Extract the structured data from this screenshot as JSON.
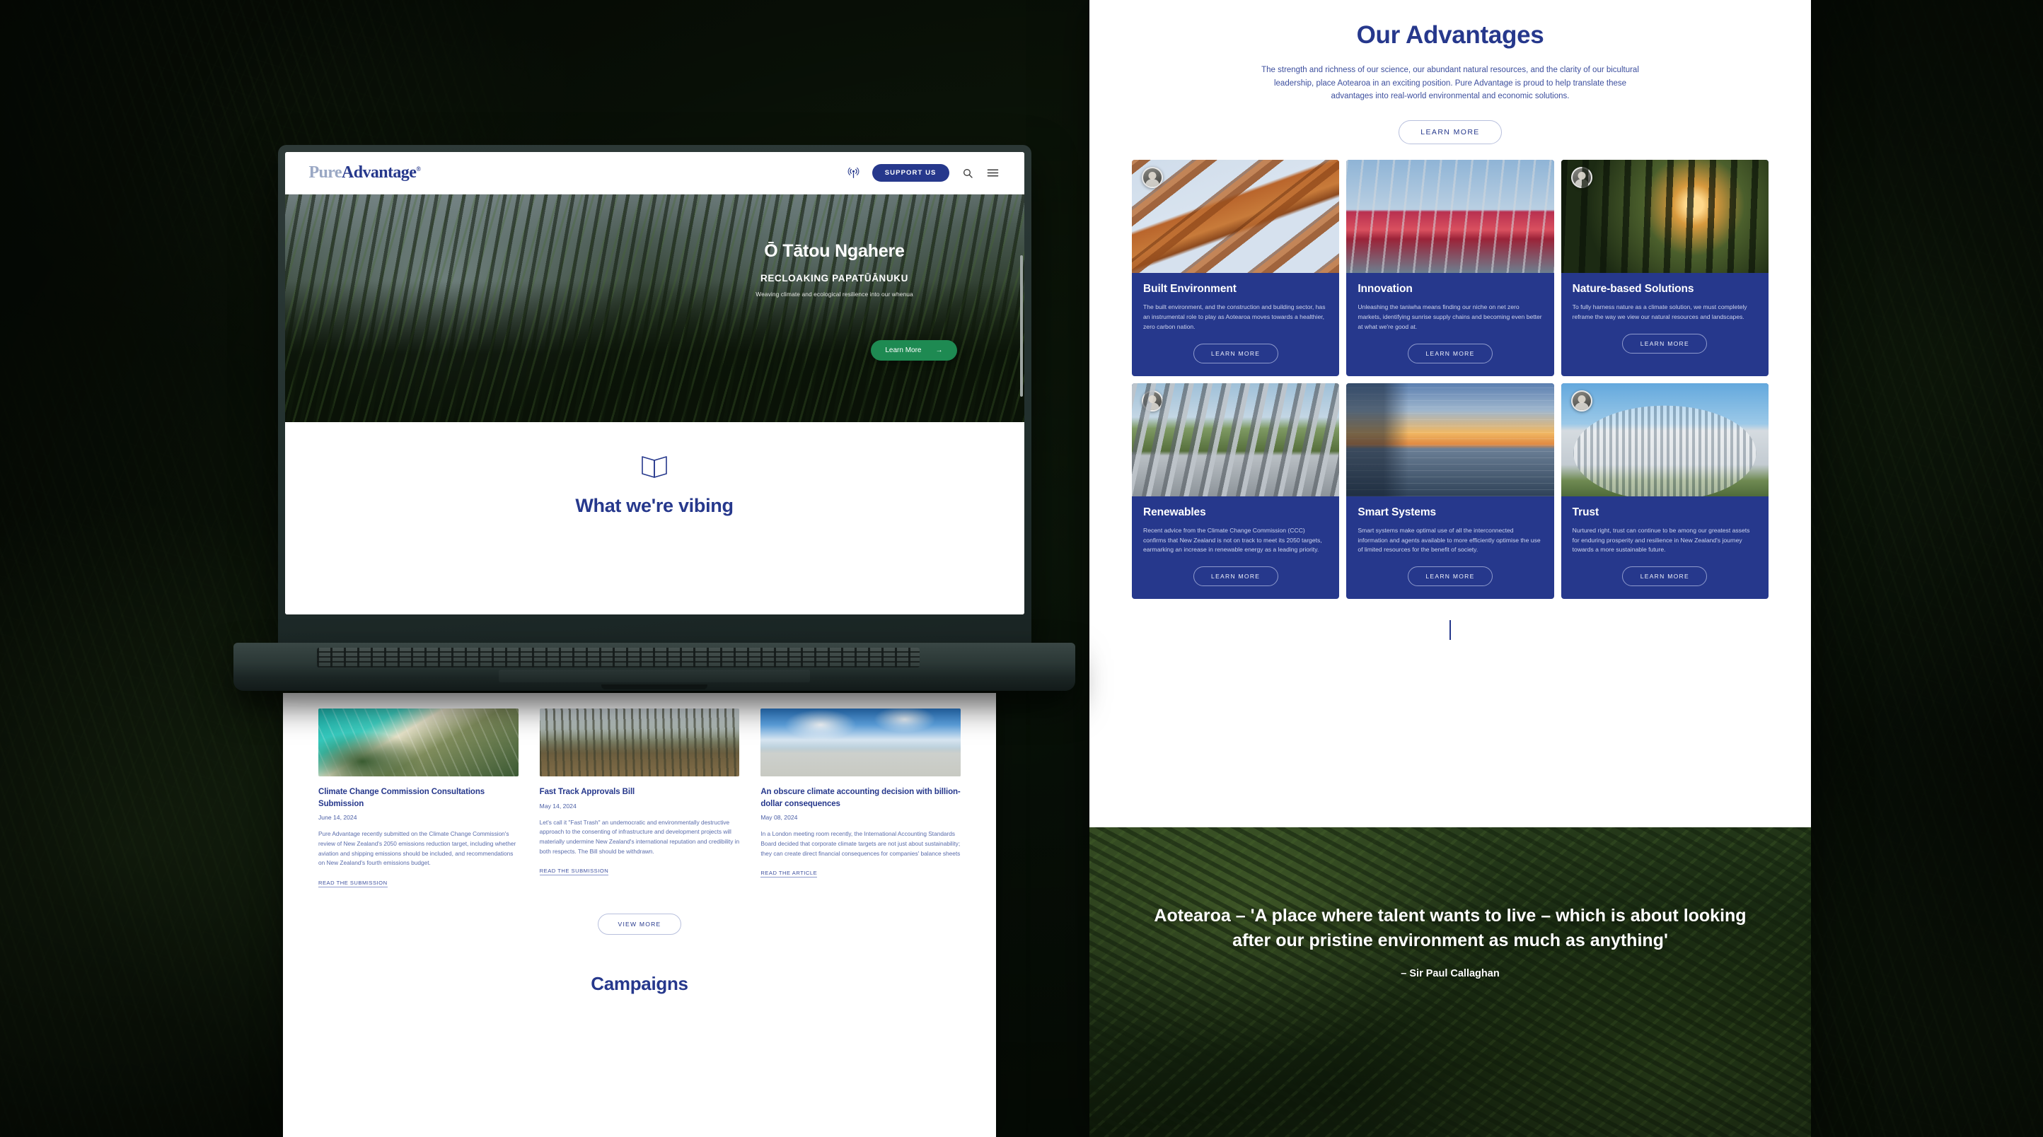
{
  "colors": {
    "brand_navy": "#26388c",
    "brand_green": "#1e8a52",
    "logo_light": "#9aa8c4",
    "card_bg": "#26388c"
  },
  "laptop_site": {
    "nav": {
      "logo_pure": "Pure",
      "logo_advantage": "Advantage",
      "logo_reg": "®",
      "podcast_icon": "podcast-icon",
      "support_label": "SUPPORT US",
      "search_icon": "search-icon",
      "menu_icon": "hamburger-menu-icon"
    },
    "hero": {
      "heading": "Ō Tātou Ngahere",
      "subheading": "RECLOAKING PAPATŪĀNUKU",
      "tagline": "Weaving climate and ecological resilience into our whenua",
      "cta_label": "Learn More",
      "cta_arrow": "→"
    },
    "vibing": {
      "icon": "open-book-icon",
      "heading": "What we're vibing"
    }
  },
  "articles_sheet": {
    "items": [
      {
        "image": "aerial-coastline-photo",
        "title": "Climate Change Commission Consultations Submission",
        "date": "June 14, 2024",
        "excerpt": "Pure Advantage recently submitted on the Climate Change Commission's review of New Zealand's 2050 emissions reduction target, including whether aviation and shipping emissions should be included, and recommendations on New Zealand's fourth emissions budget.",
        "link": "READ THE SUBMISSION"
      },
      {
        "image": "excavator-deforestation-photo",
        "title": "Fast Track Approvals Bill",
        "date": "May 14, 2024",
        "excerpt": "Let's call it \"Fast Trash\" an undemocratic and environmentally destructive approach to the consenting of infrastructure and development projects will materially undermine New Zealand's international reputation and credibility in both respects. The Bill should be withdrawn.",
        "link": "READ THE SUBMISSION"
      },
      {
        "image": "coastal-erosion-house-photo",
        "title": "An obscure climate accounting decision with billion-dollar consequences",
        "date": "May 08, 2024",
        "excerpt": "In a London meeting room recently, the International Accounting Standards Board decided that corporate climate targets are not just about sustainability; they can create direct financial consequences for companies' balance sheets",
        "link": "READ THE ARTICLE"
      }
    ],
    "view_more_label": "VIEW MORE",
    "campaigns_heading": "Campaigns"
  },
  "advantages_panel": {
    "title": "Our Advantages",
    "intro": "The strength and richness of our science, our abundant natural resources, and the clarity of our bicultural leadership, place Aotearoa in an exciting position. Pure Advantage is proud to help translate these advantages into real-world environmental and economic solutions.",
    "learn_more_label": "LEARN MORE",
    "cards": [
      {
        "image": "timber-architecture-photo",
        "badge": "author-avatar",
        "title": "Built Environment",
        "body": "The built environment, and the construction and building sector, has an instrumental role to play as Aotearoa moves towards a healthier, zero carbon nation.",
        "cta": "LEARN MORE"
      },
      {
        "image": "cyclist-pink-path-photo",
        "badge": null,
        "title": "Innovation",
        "body": "Unleashing the taniwha means finding our niche on net zero markets, identifying sunrise supply chains and becoming even better at what we're good at.",
        "cta": "LEARN MORE"
      },
      {
        "image": "forest-sunset-photo",
        "badge": "author-avatar",
        "title": "Nature-based Solutions",
        "body": "To fully harness nature as a climate solution, we must completely reframe the way we view our natural resources and landscapes.",
        "cta": "LEARN MORE"
      },
      {
        "image": "pipeline-infrastructure-photo",
        "badge": "author-avatar",
        "title": "Renewables",
        "body": "Recent advice from the Climate Change Commission (CCC) confirms that New Zealand is not on track to meet its 2050 targets, earmarking an increase in renewable energy as a leading priority.",
        "cta": "LEARN MORE"
      },
      {
        "image": "auckland-skyline-sunset-photo",
        "badge": null,
        "title": "Smart Systems",
        "body": "Smart systems make optimal use of all the interconnected information and agents available to more efficiently optimise the use of limited resources for the benefit of society.",
        "cta": "LEARN MORE"
      },
      {
        "image": "beehive-parliament-photo",
        "badge": "author-avatar",
        "title": "Trust",
        "body": "Nurtured right, trust can continue to be among our greatest assets for enduring prosperity and resilience in New Zealand's journey towards a more sustainable future.",
        "cta": "LEARN MORE"
      }
    ],
    "quote": {
      "text": "Aotearoa – 'A place where talent wants to live – which is about looking after our pristine environment as much as anything'",
      "author": "– Sir Paul Callaghan"
    }
  }
}
